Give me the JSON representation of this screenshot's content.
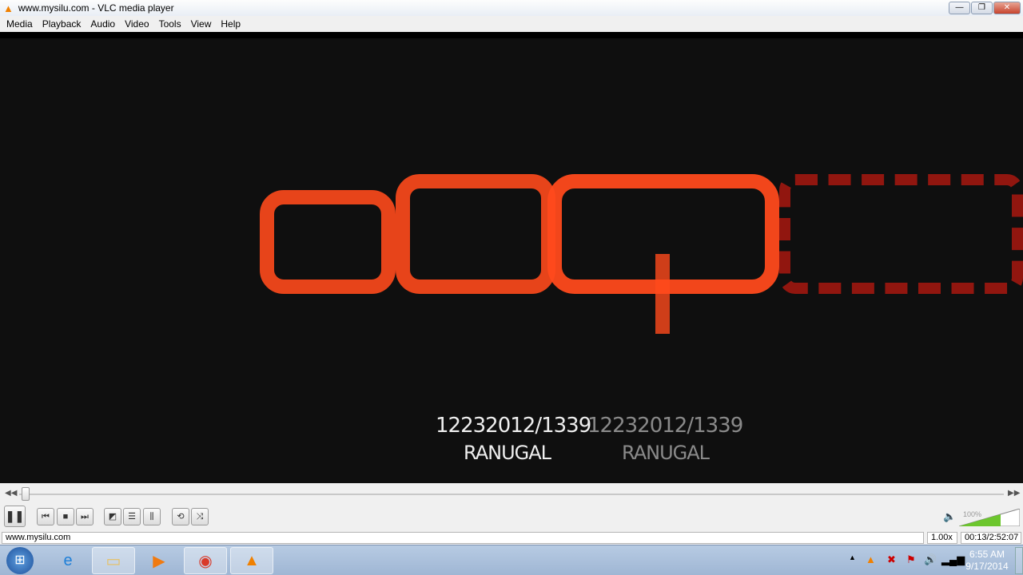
{
  "window": {
    "title": "www.mysilu.com - VLC media player"
  },
  "menu": [
    {
      "label": "Media"
    },
    {
      "label": "Playback"
    },
    {
      "label": "Audio"
    },
    {
      "label": "Video"
    },
    {
      "label": "Tools"
    },
    {
      "label": "View"
    },
    {
      "label": "Help"
    }
  ],
  "video": {
    "logo_text": "eap",
    "line1": "12232012/1339",
    "line2": "RANUGAL",
    "accent": "#ff4a1c"
  },
  "controls": {
    "seek_percent": 0.13,
    "volume_label": "100%",
    "volume_percent": 100
  },
  "status": {
    "text": "www.mysilu.com",
    "speed": "1.00x",
    "time": "00:13/2:52:07"
  },
  "taskbar": {
    "time": "6:55 AM",
    "date": "9/17/2014"
  }
}
